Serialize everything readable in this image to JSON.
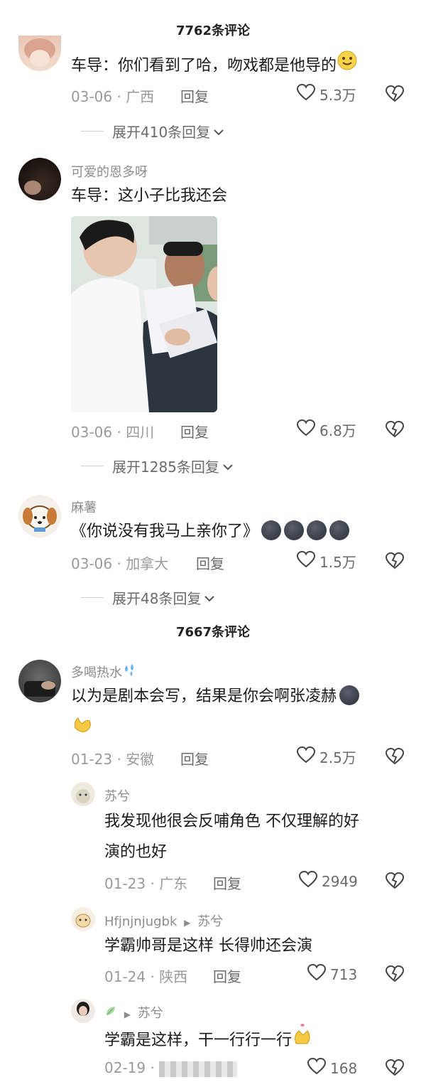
{
  "section1_title": "7762条评论",
  "section2_title": "7667条评论",
  "c1": {
    "text": "车导：你们看到了哈，吻戏都是他导的",
    "date": "03-06 · 广西",
    "reply": "回复",
    "likes": "5.3万",
    "expand": "展开410条回复"
  },
  "c2": {
    "user": "可爱的恩多呀",
    "text": "车导：这小子比我还会",
    "date": "03-06 · 四川",
    "reply": "回复",
    "likes": "6.8万",
    "expand": "展开1285条回复"
  },
  "c3": {
    "user": "麻薯",
    "text": "《你说没有我马上亲你了》",
    "date": "03-06 · 加拿大",
    "reply": "回复",
    "likes": "1.5万",
    "expand": "展开48条回复"
  },
  "c4": {
    "user": "多喝热水",
    "text_line1": "以为是剧本会写，结果是你会啊张凌赫",
    "date": "01-23 · 安徽",
    "reply": "回复",
    "likes": "2.5万"
  },
  "r1": {
    "user": "苏兮",
    "text_line1": "我发现他很会反哺角色 不仅理解的好",
    "text_line2": "演的也好",
    "date": "01-23 · 广东",
    "reply": "回复",
    "likes": "2949"
  },
  "r2": {
    "user": "Hfjnjnjugbk",
    "reply_to": "苏兮",
    "text": "学霸帅哥是这样 长得帅还会演",
    "date": "01-24 · 陕西",
    "reply": "回复",
    "likes": "713"
  },
  "r3": {
    "reply_to": "苏兮",
    "text": "学霸是这样，干一行行一行",
    "date": "02-19 ·",
    "likes": "168"
  },
  "icons": {
    "like": "heart-outline-icon",
    "dislike": "broken-heart-icon",
    "expand": "chevron-down-icon"
  }
}
